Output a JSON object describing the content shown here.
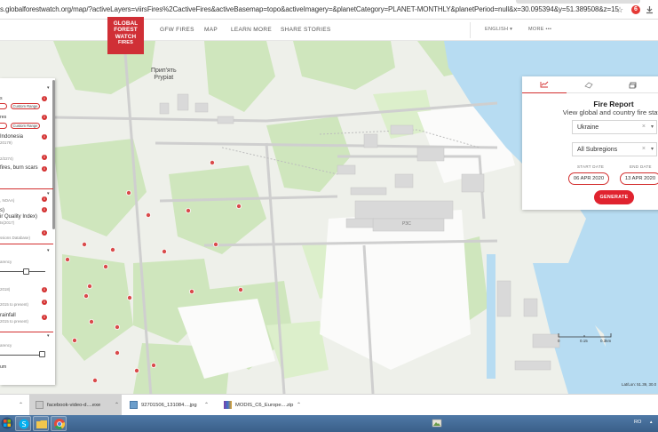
{
  "browser": {
    "url": "s.globalforestwatch.org/map/?activeLayers=viirsFires%2CactiveFires&activeBasemap=topo&activeImagery=&planetCategory=PLANET-MONTHLY&planetPeriod=null&x=30.095394&y=51.389508&z=15",
    "extension_badge": "6"
  },
  "site": {
    "logo_lines": [
      "GLOBAL",
      "FOREST",
      "WATCH",
      "FIRES"
    ],
    "nav": [
      {
        "label": "GFW FIRES"
      },
      {
        "label": "MAP"
      },
      {
        "label": "LEARN MORE"
      },
      {
        "label": "SHARE STORIES"
      }
    ],
    "language": "ENGLISH ▾",
    "more": "MORE •••"
  },
  "map": {
    "place_label_ua": "Прип'ять",
    "place_label_en": "Prypiat",
    "road_label": "РЗС",
    "scale_labels": [
      "0",
      "0.15",
      "0.3km"
    ],
    "attribution": "Lat/Lon: 51.39, 30.0"
  },
  "layers_panel": {
    "items": [
      {
        "text": "s"
      },
      {
        "text": "res"
      },
      {
        "text": "Indonesia"
      },
      {
        "text": "20179)"
      },
      {
        "text": "2/2274)"
      },
      {
        "text": "fires, burn scars"
      },
      {
        "text": ", NOAA)"
      },
      {
        "text": "s)"
      },
      {
        "text": "ir Quality Index)"
      },
      {
        "text": "ts(2017)"
      },
      {
        "text": "ssions Database)"
      },
      {
        "text": "arency"
      },
      {
        "text": "2018)"
      },
      {
        "text": "2015 to present)"
      },
      {
        "text": "rainfall"
      },
      {
        "text": "2015 to present)"
      },
      {
        "text": "arency"
      },
      {
        "text": "um"
      }
    ],
    "custom_range_label": "Custom Range"
  },
  "fire_report": {
    "title": "Fire Report",
    "subtitle": "View global and country fire statis",
    "country": "Ukraine",
    "subregion": "All Subregions",
    "start_label": "START DATE",
    "end_label": "END DATE",
    "start_date": "06 APR 2020",
    "end_date": "13 APR 2020",
    "generate_label": "GENERATE",
    "clear_glyph": "×",
    "dropdown_glyph": "▾"
  },
  "downloads": [
    {
      "name": "facebook-video-d....exe"
    },
    {
      "name": "92701506_131084....jpg"
    },
    {
      "name": "MODIS_C6_Europe....zip"
    }
  ],
  "taskbar": {
    "lang": "RO",
    "chevron": "▲"
  },
  "icons": {
    "star": "☆",
    "chevron_up": "⌃",
    "info": "i",
    "chevron_down": "▾"
  },
  "colors": {
    "brand_red": "#d02f36",
    "fire_dot": "#d94b4b",
    "water": "#b7dcf2",
    "forest": "#cde8b7"
  }
}
